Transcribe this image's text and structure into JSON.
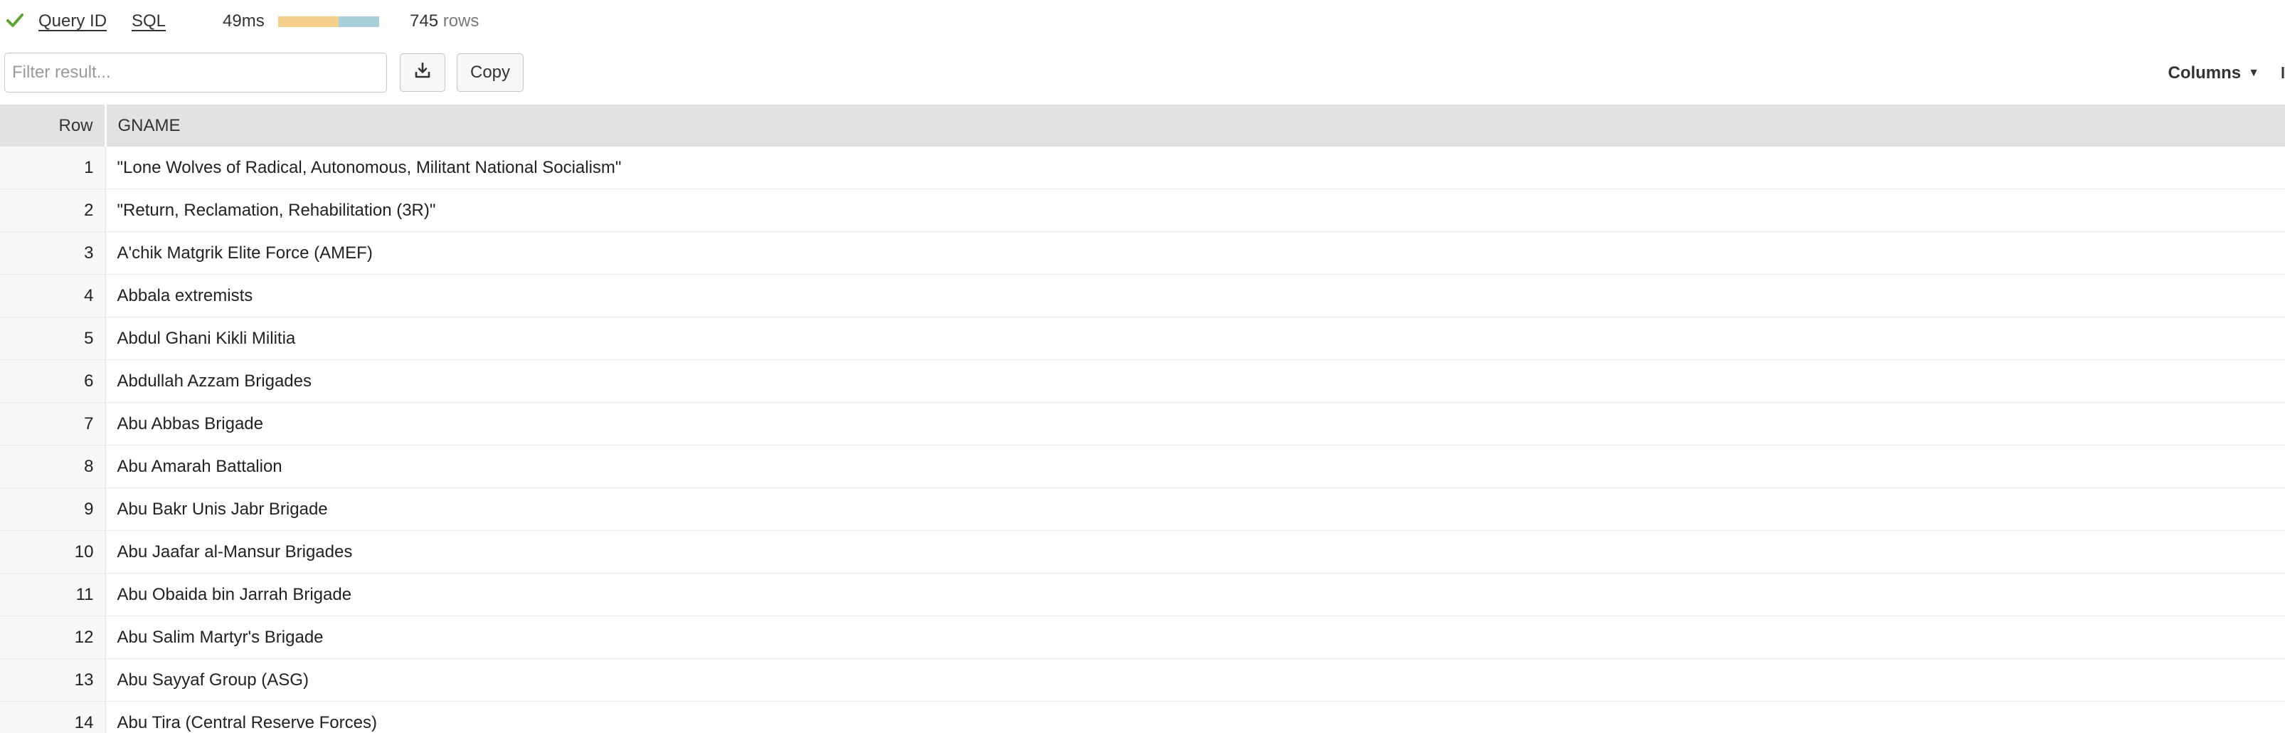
{
  "status": {
    "check_icon": "checkmark-icon",
    "check_color": "#5aa532"
  },
  "links": {
    "query_id": "Query ID",
    "sql": "SQL"
  },
  "timing": {
    "label": "49ms",
    "bar_segments": [
      {
        "color": "#f5d08a",
        "fraction": 0.6
      },
      {
        "color": "#a9cfdb",
        "fraction": 0.4
      }
    ]
  },
  "rowcount": {
    "number": "745",
    "unit": " rows"
  },
  "toolbar": {
    "filter_placeholder": "Filter result...",
    "filter_value": "",
    "download_icon": "download-icon",
    "copy_label": "Copy",
    "columns_label": "Columns",
    "columns_caret": "▼"
  },
  "table": {
    "columns": [
      "Row",
      "GNAME"
    ],
    "rows": [
      {
        "row": "1",
        "gname": "\"Lone Wolves of Radical, Autonomous, Militant National Socialism\""
      },
      {
        "row": "2",
        "gname": "\"Return, Reclamation, Rehabilitation (3R)\""
      },
      {
        "row": "3",
        "gname": "A'chik Matgrik Elite Force (AMEF)"
      },
      {
        "row": "4",
        "gname": "Abbala extremists"
      },
      {
        "row": "5",
        "gname": "Abdul Ghani Kikli Militia"
      },
      {
        "row": "6",
        "gname": "Abdullah Azzam Brigades"
      },
      {
        "row": "7",
        "gname": "Abu Abbas Brigade"
      },
      {
        "row": "8",
        "gname": "Abu Amarah Battalion"
      },
      {
        "row": "9",
        "gname": "Abu Bakr Unis Jabr Brigade"
      },
      {
        "row": "10",
        "gname": "Abu Jaafar al-Mansur Brigades"
      },
      {
        "row": "11",
        "gname": "Abu Obaida bin Jarrah Brigade"
      },
      {
        "row": "12",
        "gname": "Abu Salim Martyr's Brigade"
      },
      {
        "row": "13",
        "gname": "Abu Sayyaf Group (ASG)"
      },
      {
        "row": "14",
        "gname": "Abu Tira (Central Reserve Forces)"
      }
    ]
  }
}
